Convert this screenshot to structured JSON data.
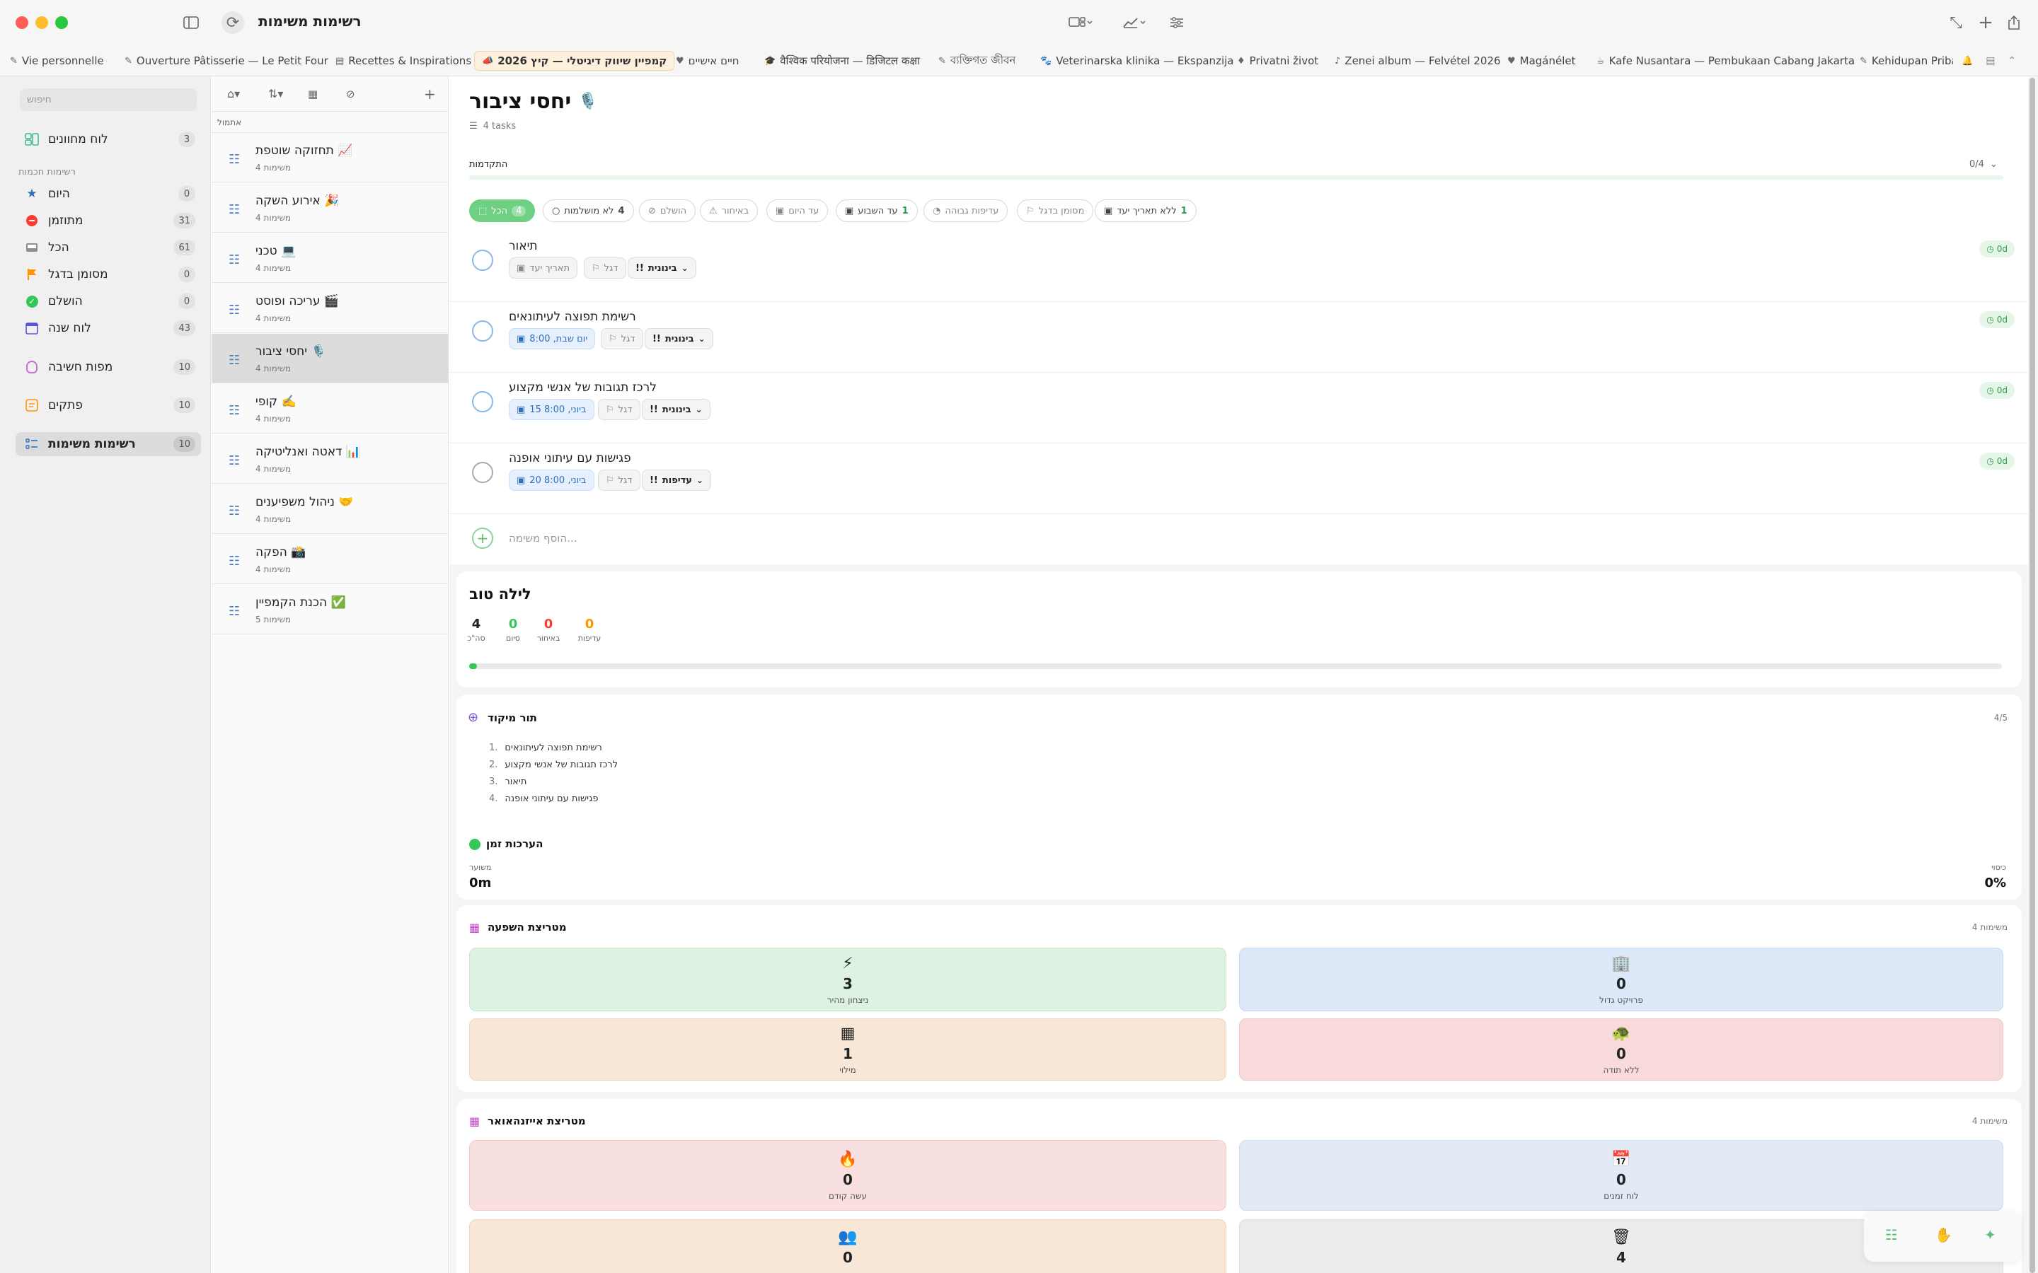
{
  "window": {
    "title": "רשימות משימות"
  },
  "tabs": [
    {
      "label": "Vie personnelle",
      "icon": "✎"
    },
    {
      "label": "Ouverture Pâtisserie — Le Petit Four",
      "icon": "✎"
    },
    {
      "label": "Recettes & Inspirations",
      "icon": "▤"
    },
    {
      "label": "קמפיין שיווק דיגיטלי — קיץ 2026",
      "icon": "📣"
    },
    {
      "label": "חיים אישיים",
      "icon": "♥"
    },
    {
      "label": "वैश्विक परियोजना — डिजिटल कक्षा",
      "icon": "🎓"
    },
    {
      "label": "ব্যক্তিগত জীবন",
      "icon": "✎"
    },
    {
      "label": "Veterinarska klinika — Ekspanzija",
      "icon": "🐾"
    },
    {
      "label": "Privatni život",
      "icon": "♦"
    },
    {
      "label": "Zenei album — Felvétel 2026",
      "icon": "♪"
    },
    {
      "label": "Magánélet",
      "icon": "♥"
    },
    {
      "label": "Kafe Nusantara — Pembukaan Cabang Jakarta",
      "icon": "☕"
    },
    {
      "label": "Kehidupan Pribadi",
      "icon": "✎"
    }
  ],
  "sidebar": {
    "search_placeholder": "חיפוש",
    "board_label": "לוח מחוונים",
    "board_count": "3",
    "smart_lists_heading": "רשימות חכמות",
    "items": [
      {
        "label": "היום",
        "count": "0"
      },
      {
        "label": "מתוזמן",
        "count": "31"
      },
      {
        "label": "הכל",
        "count": "61"
      },
      {
        "label": "מסומן בדגל",
        "count": "0"
      },
      {
        "label": "הושלם",
        "count": "0"
      },
      {
        "label": "לוח שנה",
        "count": "43"
      }
    ],
    "mindmaps_label": "מפות חשיבה",
    "mindmaps_count": "10",
    "notes_label": "פתקים",
    "notes_count": "10",
    "tasklists_label": "רשימות משימות",
    "tasklists_count": "10"
  },
  "list_column": {
    "pinned_label": "אתמול",
    "items": [
      {
        "title": "תחזוקה שוטפת 📈",
        "sub": "4 משימות"
      },
      {
        "title": "אירוע השקה 🎉",
        "sub": "4 משימות"
      },
      {
        "title": "טכני 💻",
        "sub": "4 משימות"
      },
      {
        "title": "עריכה ופוסט 🎬",
        "sub": "4 משימות"
      },
      {
        "title": "יחסי ציבור 🎙️",
        "sub": "4 משימות"
      },
      {
        "title": "קופי ✍️",
        "sub": "4 משימות"
      },
      {
        "title": "דאטה ואנליטיקה 📊",
        "sub": "4 משימות"
      },
      {
        "title": "ניהול משפיענים 🤝",
        "sub": "4 משימות"
      },
      {
        "title": "הפקה 📸",
        "sub": "4 משימות"
      },
      {
        "title": "הכנת הקמפיין ✅",
        "sub": "5 משימות"
      }
    ]
  },
  "main": {
    "title": "יחסי ציבור",
    "title_emoji": "🎙️",
    "task_count": "4 tasks",
    "progress_label": "התקדמות",
    "progress_value": "0/4",
    "progress_fraction": 0.0,
    "filters": [
      {
        "label": "הכל",
        "count": "4"
      },
      {
        "label": "לא מושלמות",
        "count": "4"
      },
      {
        "label": "הושלם",
        "count": ""
      },
      {
        "label": "באיחור",
        "count": ""
      },
      {
        "label": "עד היום",
        "count": ""
      },
      {
        "label": "עד השבוע",
        "count": "1"
      },
      {
        "label": "עדיפות גבוהה",
        "count": ""
      },
      {
        "label": "מסומן בדגל",
        "count": ""
      },
      {
        "label": "ללא תאריך יעד",
        "count": "1"
      }
    ],
    "tasks": [
      {
        "title": "תיאור",
        "date": "תאריך יעד",
        "flag": "דגל",
        "priority": "בינונית",
        "pill": "0d"
      },
      {
        "title": "רשימת תפוצה לעיתונאים",
        "date": "יום שבת, 8:00",
        "flag": "דגל",
        "priority": "בינונית",
        "pill": "0d"
      },
      {
        "title": "לרכז תגובות של אנשי מקצוע",
        "date": "15 ביוני, 8:00",
        "flag": "דגל",
        "priority": "בינונית",
        "pill": "0d"
      },
      {
        "title": "פגישות עם עיתוני אופנה",
        "date": "20 ביוני, 8:00",
        "flag": "דגל",
        "priority": "עדיפות",
        "pill": "0d"
      }
    ],
    "add_task_placeholder": "הוסף משימה...",
    "summary": {
      "greeting": "לילה טוב",
      "stats": [
        {
          "value": "4",
          "label": "סה\"כ"
        },
        {
          "value": "0",
          "label": "סיום"
        },
        {
          "value": "0",
          "label": "באיחור"
        },
        {
          "value": "0",
          "label": "עדיפות"
        }
      ],
      "progress_fraction": 0.005
    },
    "focus": {
      "title": "תור מיקוד",
      "count": "4/5",
      "items": [
        "רשימת תפוצה לעיתונאים",
        "לרכז תגובות של אנשי מקצוע",
        "תיאור",
        "פגישות עם עיתוני אופנה"
      ]
    },
    "time": {
      "title": "הערכות זמן",
      "estimate_label": "משוער",
      "estimate_value": "0m",
      "coverage_label": "כיסוי",
      "coverage_value": "0%"
    },
    "impact": {
      "title": "מטריצת השפעה",
      "count": "4 משימות",
      "cells": [
        {
          "label": "ניצחון מהיר",
          "value": "3",
          "icon": "⚡"
        },
        {
          "label": "פרויקט גדול",
          "value": "0",
          "icon": "🏢"
        },
        {
          "label": "מילוי",
          "value": "1",
          "icon": "▦"
        },
        {
          "label": "ללא תודה",
          "value": "0",
          "icon": "🐢"
        }
      ]
    },
    "eisenhower": {
      "title": "מטריצת אייזנהאואר",
      "count": "4 משימות",
      "cells": [
        {
          "label": "עשה קודם",
          "value": "0",
          "icon": "🔥"
        },
        {
          "label": "לוח זמנים",
          "value": "0",
          "icon": "📅"
        },
        {
          "label": "",
          "value": "0",
          "icon": "👥"
        },
        {
          "label": "",
          "value": "4",
          "icon": "🗑"
        }
      ]
    }
  },
  "colors": {
    "accent": "#34c759",
    "blue": "#2d6fc0",
    "red": "#ff3b30",
    "orange": "#ff9500"
  }
}
